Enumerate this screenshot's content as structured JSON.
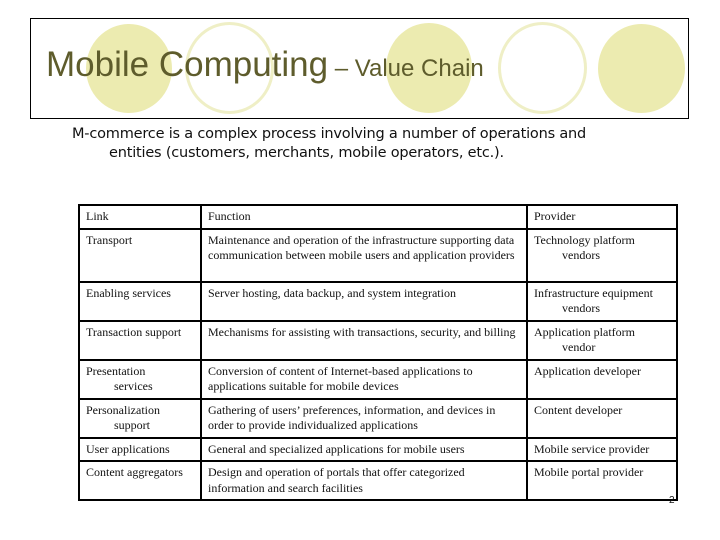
{
  "slide": {
    "title_main": "Mobile Computing",
    "title_sub": " – Value Chain",
    "intro_line1": "M-commerce is a complex process involving a number of operations and",
    "intro_line2": "entities (customers, merchants, mobile operators, etc.).",
    "page_number": "2",
    "colors": {
      "title_text": "#5e5c2c",
      "circle_fill": "#ecebb0",
      "circle_outline": "#efefc6"
    }
  },
  "table": {
    "headers": [
      "Link",
      "Function",
      "Provider"
    ],
    "rows": [
      {
        "link": [
          "Transport"
        ],
        "function": "Maintenance and operation of the infrastructure supporting data communication between mobile users and application providers",
        "provider": [
          "Technology platform",
          "vendors"
        ]
      },
      {
        "link": [
          "Enabling services"
        ],
        "function": "Server hosting, data backup, and system integration",
        "provider": [
          "Infrastructure equipment",
          "vendors"
        ]
      },
      {
        "link": [
          "Transaction support"
        ],
        "function": "Mechanisms for assisting with transactions, security, and billing",
        "provider": [
          "Application platform",
          "vendor"
        ]
      },
      {
        "link": [
          "Presentation",
          "services"
        ],
        "function": "Conversion of content of Internet-based applications to applications suitable for mobile devices",
        "provider": [
          "Application developer"
        ]
      },
      {
        "link": [
          "Personalization",
          "support"
        ],
        "function": "Gathering of users’ preferences, information, and devices in order to provide individualized applications",
        "provider": [
          "Content developer"
        ]
      },
      {
        "link": [
          "User applications"
        ],
        "function": "General and specialized applications for mobile users",
        "provider": [
          "Mobile service provider"
        ]
      },
      {
        "link": [
          "Content aggregators"
        ],
        "function": "Design and operation of portals that offer categorized information and search facilities",
        "provider": [
          "Mobile portal provider"
        ]
      }
    ]
  }
}
